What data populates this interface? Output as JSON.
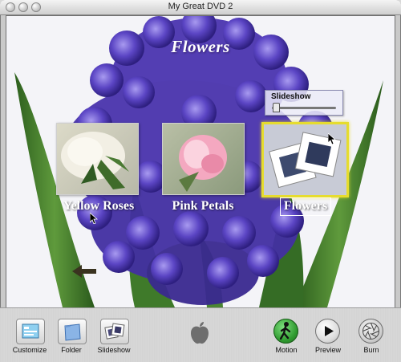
{
  "window": {
    "title": "My Great DVD 2"
  },
  "menu": {
    "title": "Flowers",
    "slideshow_popup_label": "Slideshow",
    "items": [
      {
        "label": "Yellow Roses"
      },
      {
        "label": "Pink Petals"
      },
      {
        "label": "Flowers"
      }
    ]
  },
  "toolbar": {
    "customize": "Customize",
    "folder": "Folder",
    "slideshow": "Slideshow",
    "motion": "Motion",
    "preview": "Preview",
    "burn": "Burn"
  },
  "colors": {
    "selection_highlight": "#e6dc2e",
    "motion_active": "#2f9a2f",
    "hyacinth": "#5a3fc0",
    "leaf": "#3e7a2c"
  },
  "icons": {
    "apple": "apple-logo-icon",
    "back": "back-arrow-icon",
    "motion": "walking-figure-icon",
    "preview": "play-icon",
    "burn": "burn-aperture-icon"
  }
}
